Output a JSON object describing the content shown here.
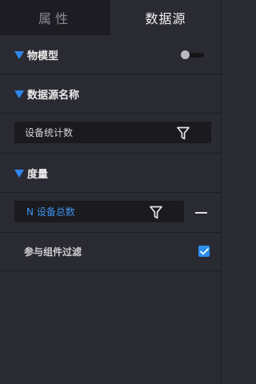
{
  "tabs": [
    {
      "label": "属性",
      "active": false
    },
    {
      "label": "数据源",
      "active": true
    }
  ],
  "sections": {
    "model": {
      "title": "物模型",
      "toggle_on": false
    },
    "datasource": {
      "title": "数据源名称",
      "value": "设备统计数"
    },
    "measure": {
      "title": "度量",
      "value": "N 设备总数"
    }
  },
  "filter_option": {
    "label": "参与组件过滤",
    "checked": true
  },
  "colors": {
    "accent": "#2f86e9",
    "background": "#2a2a33",
    "input_bg": "#1a1a1f",
    "inactive_tab": "#1c1c22"
  },
  "icons": [
    "filter-icon",
    "collapse-triangle-icon",
    "minus-icon",
    "checkmark-icon"
  ]
}
